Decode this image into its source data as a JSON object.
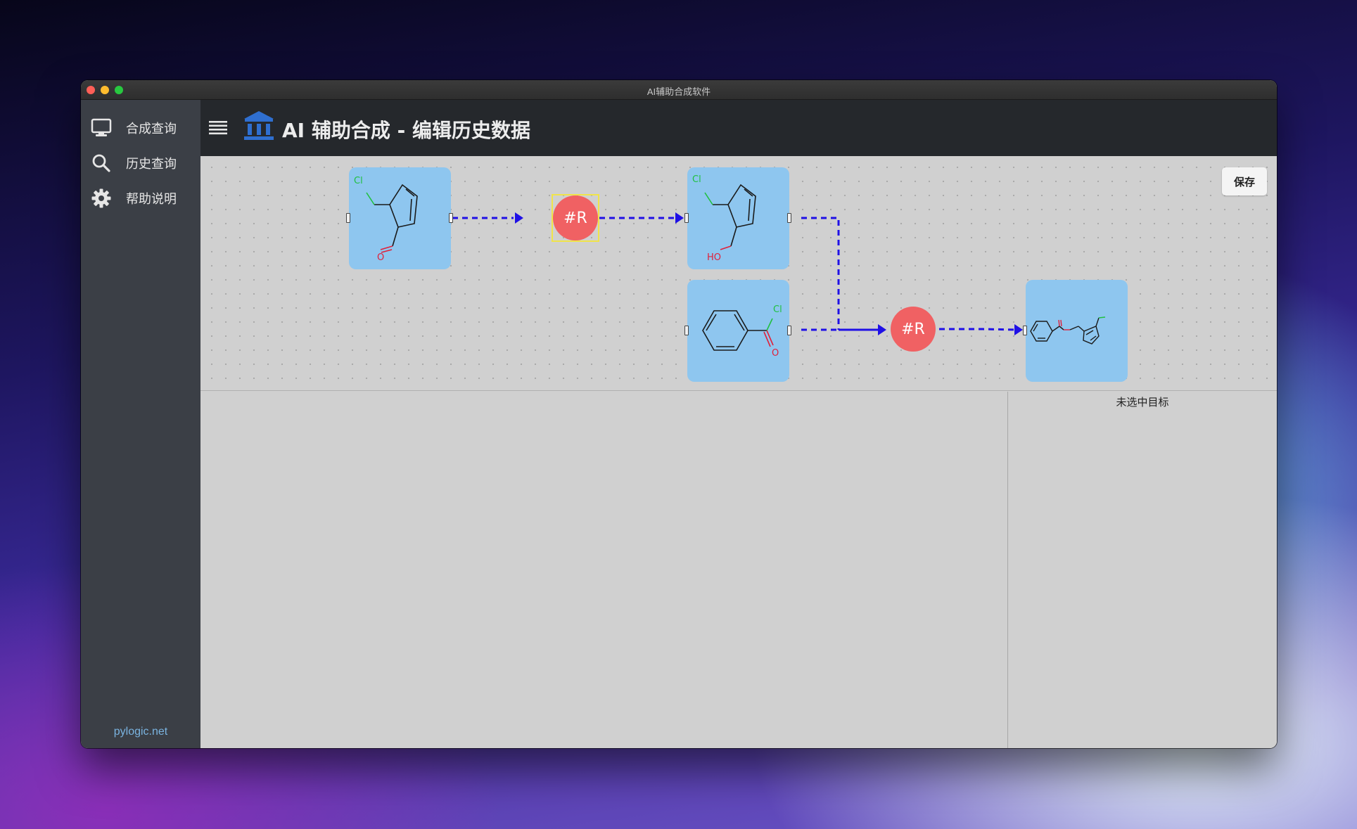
{
  "window": {
    "title": "AI辅助合成软件"
  },
  "sidebar": {
    "items": [
      {
        "label": "合成查询",
        "icon": "monitor-icon"
      },
      {
        "label": "历史查询",
        "icon": "search-icon"
      },
      {
        "label": "帮助说明",
        "icon": "gear-icon"
      }
    ],
    "footer": "pylogic.net"
  },
  "header": {
    "title": "AI 辅助合成 - 编辑历史数据",
    "menu_icon": "hamburger-menu-icon",
    "logo_icon": "bank-building-icon"
  },
  "toolbar": {
    "save_label": "保存"
  },
  "canvas": {
    "reactions": [
      {
        "label": "#R",
        "selected": true
      },
      {
        "label": "#R",
        "selected": false
      }
    ],
    "molecules": [
      {
        "atoms": [
          "Cl",
          "O"
        ]
      },
      {
        "atoms": [
          "Cl",
          "HO"
        ]
      },
      {
        "atoms": [
          "Cl",
          "O"
        ]
      },
      {
        "atoms": []
      }
    ]
  },
  "detail_panel": {
    "status": "未选中目标"
  },
  "colors": {
    "node_fill": "#8ec6ef",
    "reaction_fill": "#f06163",
    "link": "#1f10e6",
    "selection": "#f0e44a",
    "chlorine": "#20c040",
    "oxygen": "#e0203a"
  }
}
